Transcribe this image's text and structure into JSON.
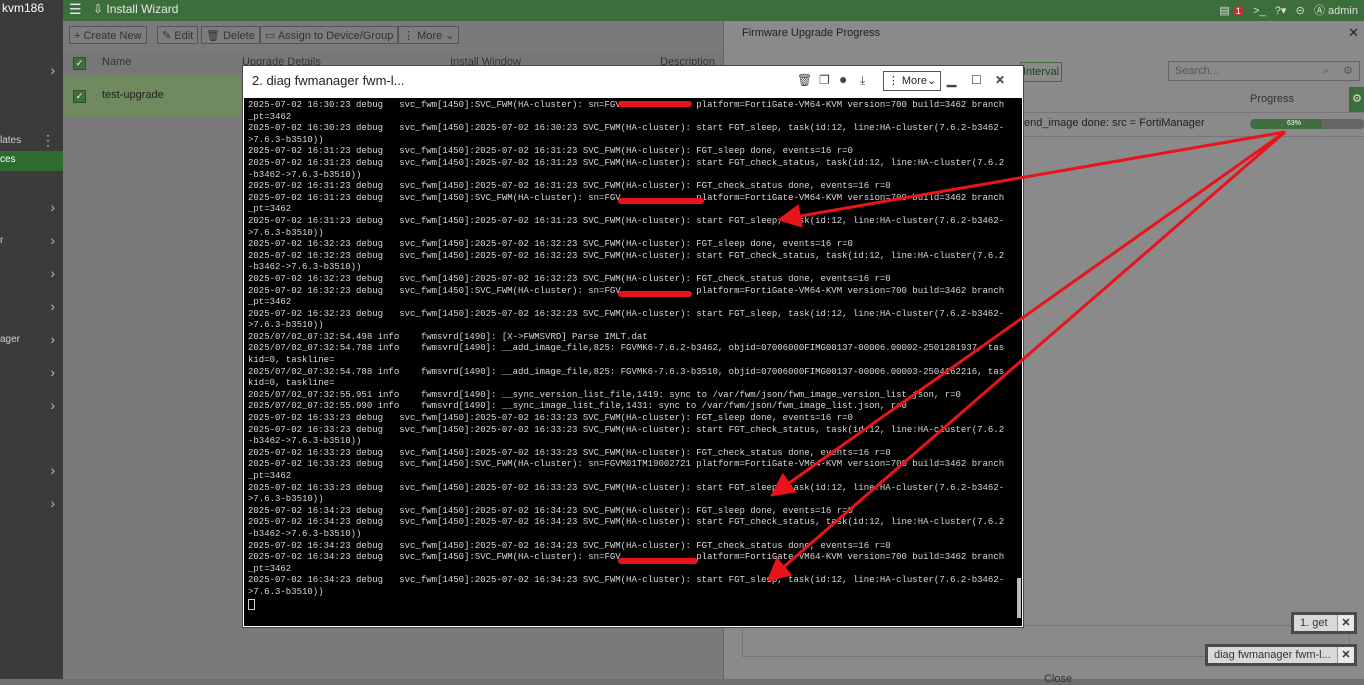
{
  "app": {
    "hostname": "kvm186",
    "wizard_label": "Install Wizard",
    "alert_count": "1",
    "user": "admin"
  },
  "leftnav": {
    "items": [
      {
        "label": "",
        "chevron": "›"
      },
      {
        "label": "lates",
        "chevron": "⋮"
      },
      {
        "label": "ces",
        "chevron": ""
      },
      {
        "label": "",
        "chevron": "›"
      },
      {
        "label": "r",
        "chevron": "›"
      },
      {
        "label": "",
        "chevron": "›"
      },
      {
        "label": "",
        "chevron": "›"
      },
      {
        "label": "ager",
        "chevron": "›"
      },
      {
        "label": "",
        "chevron": "›"
      },
      {
        "label": "",
        "chevron": "›"
      },
      {
        "label": "",
        "chevron": "›"
      },
      {
        "label": "",
        "chevron": "›"
      }
    ]
  },
  "toolbar": {
    "create_new": "+ Create New",
    "edit": "Edit",
    "delete": "Delete",
    "assign": "Assign to Device/Group",
    "more": "More"
  },
  "grid": {
    "columns": [
      "Name",
      "Upgrade Details",
      "Install Window",
      "Description"
    ],
    "rows": [
      {
        "name": "test-upgrade"
      }
    ]
  },
  "firmware_panel": {
    "title": "Firmware Upgrade Progress",
    "search_placeholder": "Search...",
    "interval_label": "Interval",
    "progress_header": "Progress",
    "row_status": "end_image done: src = FortiManager",
    "progress_pct": 63,
    "progress_label": "63%",
    "close_label": "Close"
  },
  "terminal": {
    "title": "2. diag fwmanager fwm-l...",
    "more_label": "More",
    "log_lines": [
      "2025-07-02 16:30:23 debug   svc_fwm[1450]:SVC_FWM(HA-cluster): sn=FGV              platform=FortiGate-VM64-KVM version=700 build=3462 branch",
      "_pt=3462",
      "2025-07-02 16:30:23 debug   svc_fwm[1450]:2025-07-02 16:30:23 SVC_FWM(HA-cluster): start FGT_sleep, task(id:12, line:HA-cluster(7.6.2-b3462-",
      ">7.6.3-b3510))",
      "2025-07-02 16:31:23 debug   svc_fwm[1450]:2025-07-02 16:31:23 SVC_FWM(HA-cluster): FGT_sleep done, events=16 r=0",
      "2025-07-02 16:31:23 debug   svc_fwm[1450]:2025-07-02 16:31:23 SVC_FWM(HA-cluster): start FGT_check_status, task(id:12, line:HA-cluster(7.6.2",
      "-b3462->7.6.3-b3510))",
      "2025-07-02 16:31:23 debug   svc_fwm[1450]:2025-07-02 16:31:23 SVC_FWM(HA-cluster): FGT_check_status done, events=16 r=0",
      "2025-07-02 16:31:23 debug   svc_fwm[1450]:SVC_FWM(HA-cluster): sn=FGV              platform=FortiGate-VM64-KVM version=700 build=3462 branch",
      "_pt=3462",
      "2025-07-02 16:31:23 debug   svc_fwm[1450]:2025-07-02 16:31:23 SVC_FWM(HA-cluster): start FGT_sleep, task(id:12, line:HA-cluster(7.6.2-b3462-",
      ">7.6.3-b3510))",
      "2025-07-02 16:32:23 debug   svc_fwm[1450]:2025-07-02 16:32:23 SVC_FWM(HA-cluster): FGT_sleep done, events=16 r=0",
      "2025-07-02 16:32:23 debug   svc_fwm[1450]:2025-07-02 16:32:23 SVC_FWM(HA-cluster): start FGT_check_status, task(id:12, line:HA-cluster(7.6.2",
      "-b3462->7.6.3-b3510))",
      "2025-07-02 16:32:23 debug   svc_fwm[1450]:2025-07-02 16:32:23 SVC_FWM(HA-cluster): FGT_check_status done, events=16 r=0",
      "2025-07-02 16:32:23 debug   svc_fwm[1450]:SVC_FWM(HA-cluster): sn=FGV              platform=FortiGate-VM64-KVM version=700 build=3462 branch",
      "_pt=3462",
      "2025-07-02 16:32:23 debug   svc_fwm[1450]:2025-07-02 16:32:23 SVC_FWM(HA-cluster): start FGT_sleep, task(id:12, line:HA-cluster(7.6.2-b3462-",
      ">7.6.3-b3510))",
      "2025/07/02_07:32:54.498 info    fwmsvrd[1490]: [X->FWMSVRD] Parse IMLT.dat",
      "2025/07/02_07:32:54.788 info    fwmsvrd[1490]: __add_image_file,825: FGVMK6-7.6.2-b3462, objid=07006000FIMG00137-00006.00002-2501281937, tas",
      "kid=0, taskline=",
      "2025/07/02_07:32:54.788 info    fwmsvrd[1490]: __add_image_file,825: FGVMK6-7.6.3-b3510, objid=07006000FIMG00137-00006.00003-2504162216, tas",
      "kid=0, taskline=",
      "2025/07/02_07:32:55.951 info    fwmsvrd[1490]: __sync_version_list_file,1419: sync to /var/fwm/json/fwm_image_version_list.json, r=0",
      "2025/07/02_07:32:55.990 info    fwmsvrd[1490]: __sync_image_list_file,1431: sync to /var/fwm/json/fwm_image_list.json, r=0",
      "2025-07-02 16:33:23 debug   svc_fwm[1450]:2025-07-02 16:33:23 SVC_FWM(HA-cluster): FGT_sleep done, events=16 r=0",
      "2025-07-02 16:33:23 debug   svc_fwm[1450]:2025-07-02 16:33:23 SVC_FWM(HA-cluster): start FGT_check_status, task(id:12, line:HA-cluster(7.6.2",
      "-b3462->7.6.3-b3510))",
      "2025-07-02 16:33:23 debug   svc_fwm[1450]:2025-07-02 16:33:23 SVC_FWM(HA-cluster): FGT_check_status done, events=16 r=0",
      "2025-07-02 16:33:23 debug   svc_fwm[1450]:SVC_FWM(HA-cluster): sn=FGVM01TM19002721 platform=FortiGate-VM64-KVM version=700 build=3462 branch",
      "_pt=3462",
      "2025-07-02 16:33:23 debug   svc_fwm[1450]:2025-07-02 16:33:23 SVC_FWM(HA-cluster): start FGT_sleep, task(id:12, line:HA-cluster(7.6.2-b3462-",
      ">7.6.3-b3510))",
      "2025-07-02 16:34:23 debug   svc_fwm[1450]:2025-07-02 16:34:23 SVC_FWM(HA-cluster): FGT_sleep done, events=16 r=0",
      "2025-07-02 16:34:23 debug   svc_fwm[1450]:2025-07-02 16:34:23 SVC_FWM(HA-cluster): start FGT_check_status, task(id:12, line:HA-cluster(7.6.2",
      "-b3462->7.6.3-b3510))",
      "2025-07-02 16:34:23 debug   svc_fwm[1450]:2025-07-02 16:34:23 SVC_FWM(HA-cluster): FGT_check_status done, events=16 r=0",
      "2025-07-02 16:34:23 debug   svc_fwm[1450]:SVC_FWM(HA-cluster): sn=FGV              platform=FortiGate-VM64-KVM version=700 build=3462 branch",
      "_pt=3462",
      "2025-07-02 16:34:23 debug   svc_fwm[1450]:2025-07-02 16:34:23 SVC_FWM(HA-cluster): start FGT_sleep, task(id:12, line:HA-cluster(7.6.2-b3462-",
      ">7.6.3-b3510))"
    ]
  },
  "bottom_tabs": [
    {
      "label": "1. get"
    },
    {
      "label": "diag fwmanager fwm-l..."
    }
  ],
  "colors": {
    "brand_green": "#3c6e3c",
    "annotation_red": "#e8141c"
  }
}
